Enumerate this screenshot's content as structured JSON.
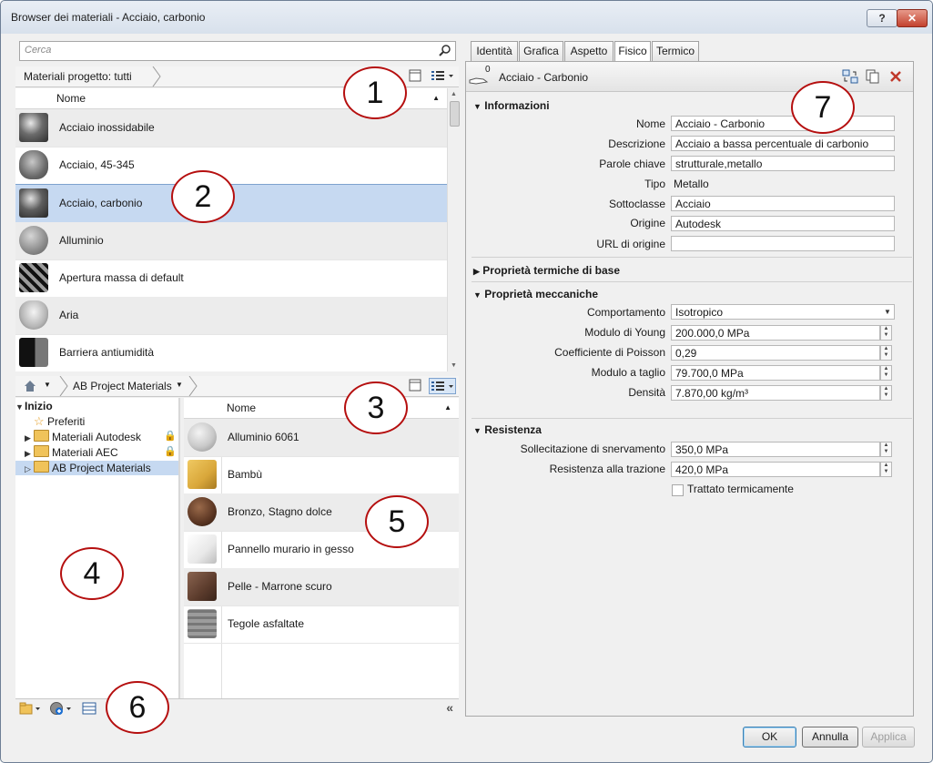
{
  "window": {
    "title": "Browser dei materiali - Acciaio, carbonio",
    "help_label": "?",
    "close_label": "✕"
  },
  "search": {
    "placeholder": "Cerca"
  },
  "project": {
    "breadcrumb": "Materiali progetto: tutti",
    "column_header": "Nome",
    "materials": [
      {
        "name": "Acciaio inossidabile",
        "thumb": "chrome-sphere",
        "color": "#6b6b6b"
      },
      {
        "name": "Acciaio, 45-345",
        "thumb": "egg",
        "color": "#8a8a8a"
      },
      {
        "name": "Acciaio, carbonio",
        "thumb": "chrome-sphere",
        "color": "#5e5e5e"
      },
      {
        "name": "Alluminio",
        "thumb": "sphere",
        "color": "#9a9a9a"
      },
      {
        "name": "Apertura massa di default",
        "thumb": "pattern",
        "color": "#333333"
      },
      {
        "name": "Aria",
        "thumb": "bowl",
        "color": "#b5b5b5"
      },
      {
        "name": "Barriera antiumidità",
        "thumb": "dark-cube",
        "color": "#222222"
      }
    ],
    "selected_index": 2
  },
  "library": {
    "breadcrumb": "AB Project Materials",
    "column_header": "Nome",
    "tree": {
      "root": "Inizio",
      "items": [
        {
          "label": "Preferiti",
          "icon": "star-icon"
        },
        {
          "label": "Materiali Autodesk",
          "icon": "folder-icon",
          "locked": true
        },
        {
          "label": "Materiali AEC",
          "icon": "folder-icon",
          "locked": true
        },
        {
          "label": "AB Project Materials",
          "icon": "folder-icon",
          "selected": true
        }
      ]
    },
    "materials": [
      {
        "name": "Alluminio 6061",
        "color": "#c9c9c9"
      },
      {
        "name": "Bambù",
        "color": "#d9a73a"
      },
      {
        "name": "Bronzo, Stagno dolce",
        "color": "#5a3522"
      },
      {
        "name": "Pannello murario in gesso",
        "color": "#e8e8e8"
      },
      {
        "name": "Pelle - Marrone scuro",
        "color": "#5b3b2c"
      },
      {
        "name": "Tegole asfaltate",
        "color": "#8c8c8c"
      }
    ]
  },
  "tabs": [
    "Identità",
    "Grafica",
    "Aspetto",
    "Fisico",
    "Termico"
  ],
  "active_tab": "Fisico",
  "asset": {
    "name": "Acciaio - Carbonio",
    "usage_count": "0"
  },
  "sections": {
    "info": "Informazioni",
    "thermal": "Proprietà termiche di base",
    "mechanical": "Proprietà meccaniche",
    "strength": "Resistenza"
  },
  "info": {
    "nome_label": "Nome",
    "nome": "Acciaio - Carbonio",
    "descrizione_label": "Descrizione",
    "descrizione": "Acciaio a bassa percentuale di carbonio",
    "parole_label": "Parole chiave",
    "parole": "strutturale,metallo",
    "tipo_label": "Tipo",
    "tipo": "Metallo",
    "sottoclasse_label": "Sottoclasse",
    "sottoclasse": "Acciaio",
    "origine_label": "Origine",
    "origine": "Autodesk",
    "url_label": "URL di origine",
    "url": ""
  },
  "mechanical": {
    "comportamento_label": "Comportamento",
    "comportamento": "Isotropico",
    "young_label": "Modulo di Young",
    "young": "200.000,0 MPa",
    "poisson_label": "Coefficiente di Poisson",
    "poisson": "0,29",
    "taglio_label": "Modulo a taglio",
    "taglio": "79.700,0 MPa",
    "densita_label": "Densità",
    "densita": "7.870,00 kg/m³"
  },
  "strength": {
    "snervamento_label": "Sollecitazione di snervamento",
    "snervamento": "350,0 MPa",
    "trazione_label": "Resistenza alla trazione",
    "trazione": "420,0 MPa",
    "trattato_label": "Trattato termicamente",
    "trattato": false
  },
  "buttons": {
    "ok": "OK",
    "cancel": "Annulla",
    "apply": "Applica"
  },
  "callouts": [
    "1",
    "2",
    "3",
    "4",
    "5",
    "6",
    "7"
  ]
}
